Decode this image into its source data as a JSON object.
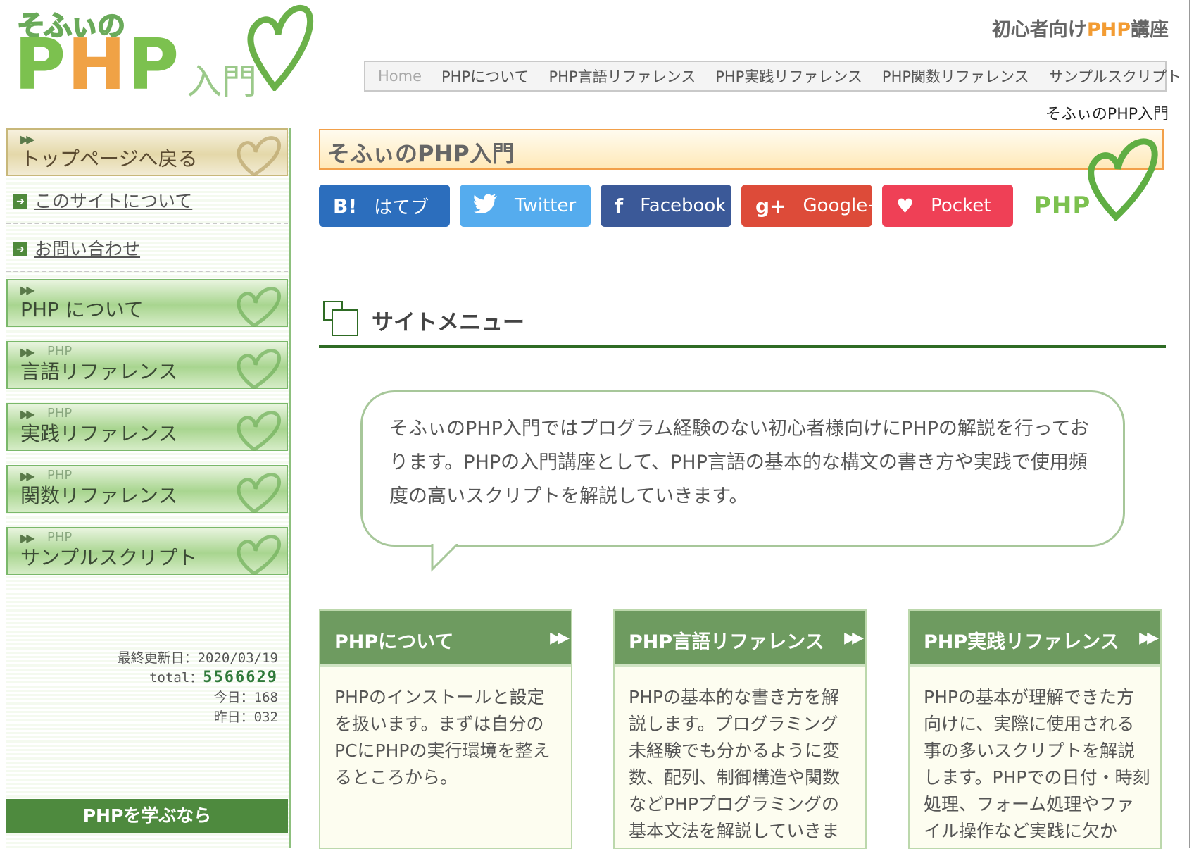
{
  "logo": {
    "small": "そふぃの",
    "big_p1": "P",
    "big_h": "H",
    "big_p2": "P",
    "nyumon": "入門"
  },
  "tagline": {
    "before": "初心者向け",
    "php": "PHP",
    "after": "講座"
  },
  "topnav": [
    "Home",
    "PHPについて",
    "PHP言語リファレンス",
    "PHP実践リファレンス",
    "PHP関数リファレンス",
    "サンプルスクリプト"
  ],
  "breadcrumb": "そふぃのPHP入門",
  "sidebar": {
    "top_button": "トップページへ戻る",
    "links": [
      "このサイトについて",
      "お問い合わせ"
    ],
    "menu": [
      {
        "sub": "",
        "label": "PHP について"
      },
      {
        "sub": "PHP",
        "label": "言語リファレンス"
      },
      {
        "sub": "PHP",
        "label": "実践リファレンス"
      },
      {
        "sub": "PHP",
        "label": "関数リファレンス"
      },
      {
        "sub": "PHP",
        "label": "サンプルスクリプト"
      }
    ],
    "counter": {
      "updated_label": "最終更新日：",
      "updated": "2020/03/19",
      "total_label": "total：",
      "total": "5566629",
      "today_label": "今日：",
      "today": "168",
      "yesterday_label": "昨日：",
      "yesterday": "032"
    },
    "learn": "PHPを学ぶなら"
  },
  "main": {
    "title": "そふぃのPHP入門",
    "php_mark": "PHP",
    "share": [
      {
        "glyph": "B!",
        "label": "はてブ",
        "color": "#2c6ebd"
      },
      {
        "glyph": "✔",
        "label": "Twitter",
        "color": "#55acee"
      },
      {
        "glyph": "f",
        "label": "Facebook",
        "color": "#3b5998"
      },
      {
        "glyph": "g+",
        "label": "Google+",
        "color": "#dd4b39"
      },
      {
        "glyph": "♥",
        "label": "Pocket",
        "color": "#ef4056"
      }
    ],
    "section_title": "サイトメニュー",
    "intro": "そふぃのPHP入門ではプログラム経験のない初心者様向けにPHPの解説を行っております。PHPの入門講座として、PHP言語の基本的な構文の書き方や実践で使用頻度の高いスクリプトを解説していきます。",
    "cards": [
      {
        "title": "PHPについて",
        "body": "PHPのインストールと設定を扱います。まずは自分のPCにPHPの実行環境を整えるところから。"
      },
      {
        "title": "PHP言語リファレンス",
        "body": "PHPの基本的な書き方を解説します。プログラミング未経験でも分かるように変数、配列、制御構造や関数などPHPプログラミングの基本文法を解説していきま"
      },
      {
        "title": "PHP実践リファレンス",
        "body": "PHPの基本が理解できた方向けに、実際に使用される事の多いスクリプトを解説します。PHPでの日付・時刻処理、フォーム処理やファイル操作など実践に欠か"
      }
    ]
  }
}
